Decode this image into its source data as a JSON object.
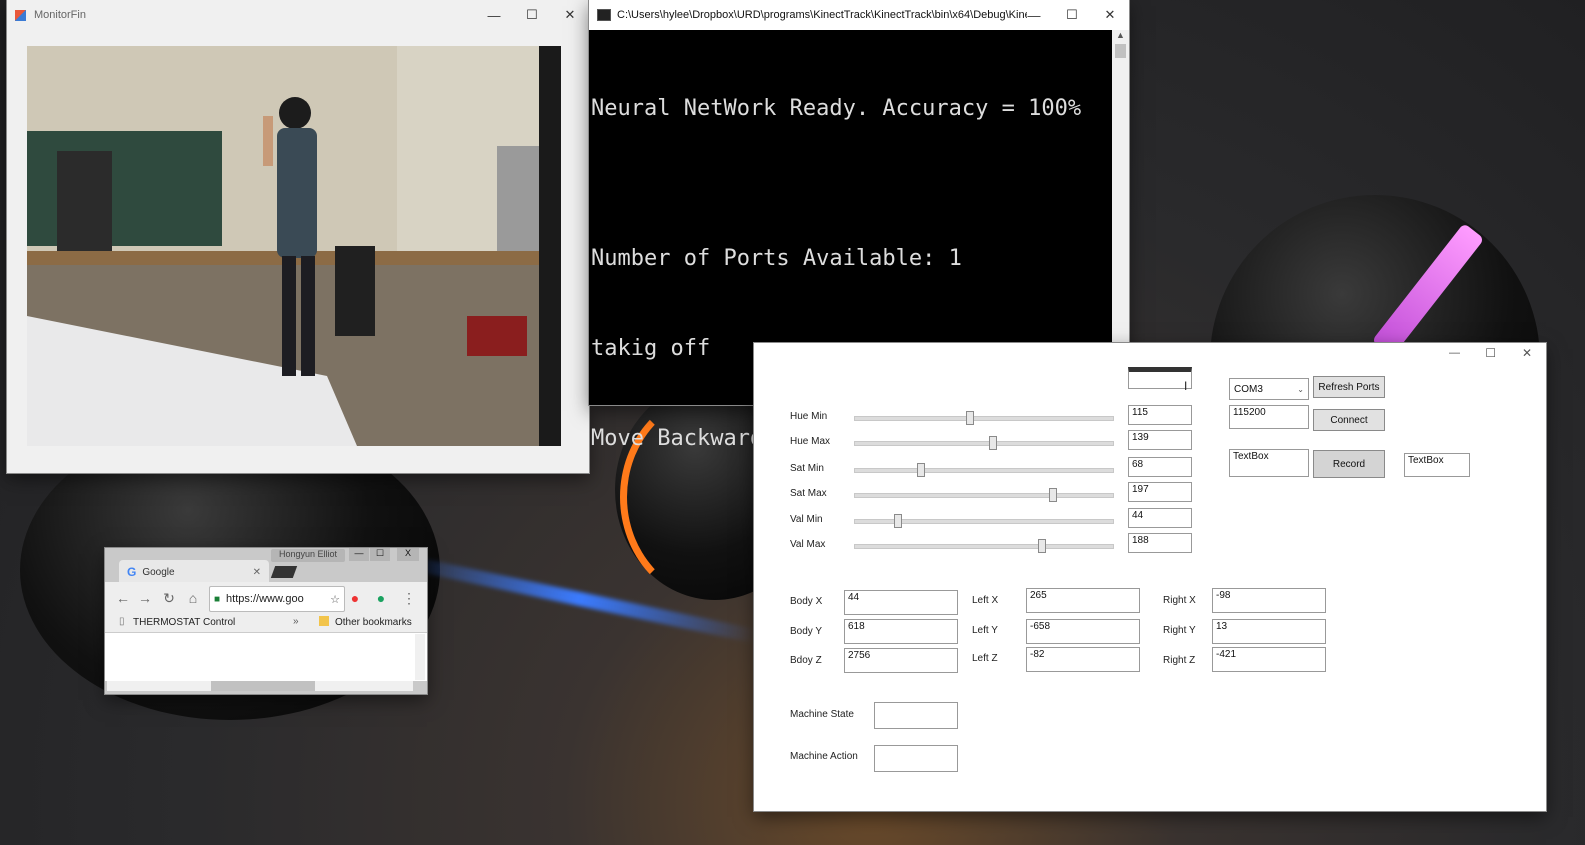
{
  "monitor_window": {
    "title": "MonitorFin",
    "minimize": "—",
    "maximize": "☐",
    "close": "✕"
  },
  "console_window": {
    "title": "C:\\Users\\hylee\\Dropbox\\URD\\programs\\KinectTrack\\KinectTrack\\bin\\x64\\Debug\\Kinect...",
    "lines": [
      "Neural NetWork Ready. Accuracy = 100%",
      "",
      "Number of Ports Available: 1",
      "takig off",
      "Move Backward.   Set point --"
    ],
    "minimize": "—",
    "maximize": "☐",
    "close": "✕"
  },
  "chrome_window": {
    "profile": "Hongyun Elliot",
    "tab_title": "Google",
    "url": "https://www.goo",
    "bookmark_1": "THERMOSTAT Control",
    "bookmarks_more": "»",
    "bookmark_2": "Other bookmarks",
    "minimize": "—",
    "maximize": "☐",
    "close": "X"
  },
  "form_window": {
    "minimize": "—",
    "maximize": "☐",
    "close": "✕",
    "sliders": [
      {
        "label": "Hue Min",
        "value": "115",
        "level": 0.45
      },
      {
        "label": "Hue Max",
        "value": "139",
        "level": 0.54
      },
      {
        "label": "Sat Min",
        "value": "68",
        "level": 0.26
      },
      {
        "label": "Sat Max",
        "value": "197",
        "level": 0.77
      },
      {
        "label": "Val Min",
        "value": "44",
        "level": 0.17
      },
      {
        "label": "Val Max",
        "value": "188",
        "level": 0.73
      }
    ],
    "com_port": "COM3",
    "refresh_ports": "Refresh Ports",
    "baud": "115200",
    "connect": "Connect",
    "textbox_1": "TextBox",
    "record": "Record",
    "textbox_2": "TextBox",
    "body_x_label": "Body X",
    "body_x": "44",
    "body_y_label": "Body Y",
    "body_y": "618",
    "body_z_label": "Bdoy Z",
    "body_z": "2756",
    "left_x_label": "Left X",
    "left_x": "265",
    "left_y_label": "Left Y",
    "left_y": "-658",
    "left_z_label": "Left Z",
    "left_z": "-82",
    "right_x_label": "Right X",
    "right_x": "-98",
    "right_y_label": "Right Y",
    "right_y": "13",
    "right_z_label": "Right Z",
    "right_z": "-421",
    "machine_state_label": "Machine State",
    "machine_state": "",
    "machine_action_label": "Machine Action",
    "machine_action": ""
  }
}
